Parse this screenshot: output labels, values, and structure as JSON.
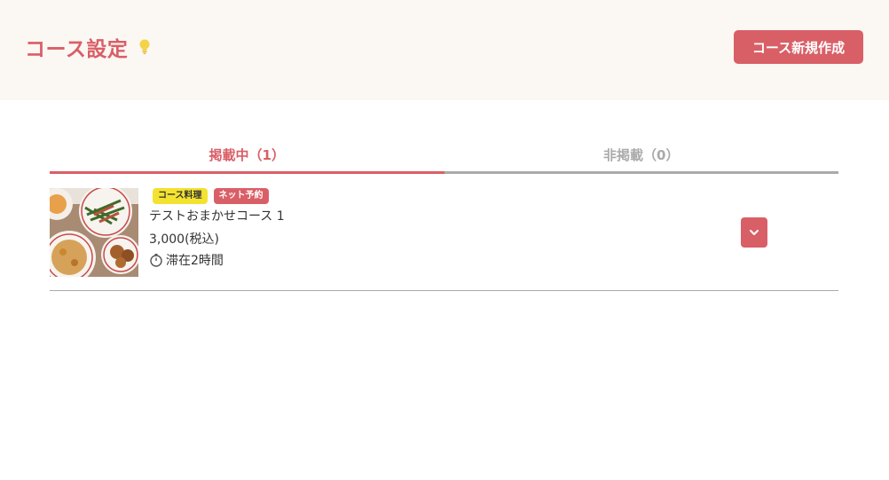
{
  "header": {
    "title": "コース設定",
    "new_button_label": "コース新規作成"
  },
  "tabs": [
    {
      "label": "掲載中（1）",
      "active": true
    },
    {
      "label": "非掲載（0）",
      "active": false
    }
  ],
  "courses": [
    {
      "badges": [
        {
          "label": "コース料理",
          "color": "#f3e22f"
        },
        {
          "label": "ネット予約",
          "color": "#d95f67"
        }
      ],
      "name": "テストおまかせコース 1",
      "price": "3,000(税込)",
      "stay": "滞在2時間",
      "image": "food-photo"
    }
  ],
  "colors": {
    "accent": "#d95f67",
    "header_bg": "#fbf7f3",
    "inactive": "#aaaaaa",
    "badge_yellow": "#f3e22f"
  },
  "icons": [
    "lightbulb-icon",
    "clock-icon",
    "chevron-down-icon"
  ]
}
